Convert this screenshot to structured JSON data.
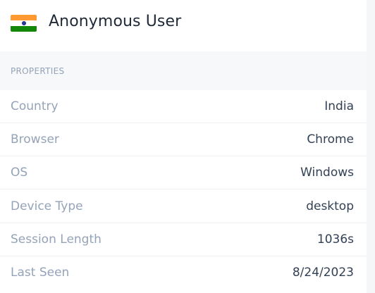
{
  "header": {
    "title": "Anonymous User",
    "flag_icon": "india-flag-icon"
  },
  "section": {
    "label": "PROPERTIES"
  },
  "properties": [
    {
      "key": "Country",
      "value": "India"
    },
    {
      "key": "Browser",
      "value": "Chrome"
    },
    {
      "key": "OS",
      "value": "Windows"
    },
    {
      "key": "Device Type",
      "value": "desktop"
    },
    {
      "key": "Session Length",
      "value": "1036s"
    },
    {
      "key": "Last Seen",
      "value": "8/24/2023"
    }
  ],
  "colors": {
    "title": "#1f2937",
    "label": "#94a3b8",
    "value": "#334155",
    "section_bg": "#f7f8fa"
  }
}
